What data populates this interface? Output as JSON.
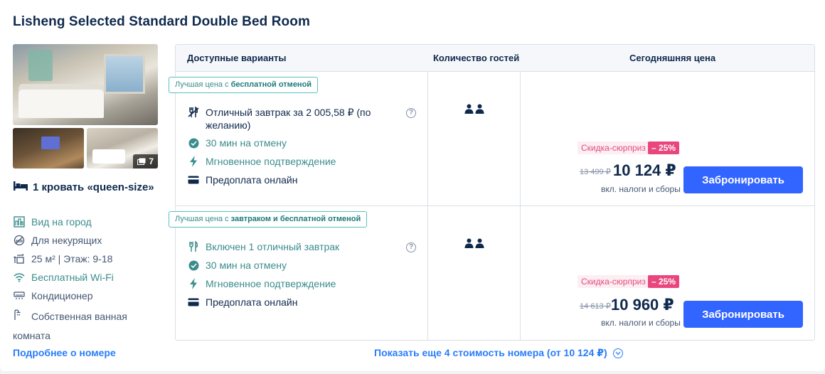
{
  "room": {
    "title": "Lisheng Selected Standard Double Bed Room",
    "photo_count": "7",
    "bed": "1 кровать «queen-size»",
    "amenities": {
      "view": "Вид на город",
      "smoking": "Для некурящих",
      "size_floor": "25 м² | Этаж: 9-18",
      "wifi": "Бесплатный Wi-Fi",
      "ac": "Кондиционер",
      "bathroom": "Собственная ванная комната"
    },
    "more_link": "Подробнее о номере"
  },
  "table": {
    "headers": {
      "options": "Доступные варианты",
      "guests": "Количество гостей",
      "price": "Сегодняшняя цена"
    },
    "offers": [
      {
        "badge_prefix": "Лучшая цена с ",
        "badge_bold": "бесплатной отменой",
        "meal": "Отличный завтрак за 2 005,58 ₽ (по желанию)",
        "cancel": "30 мин на отмену",
        "confirm": "Мгновенное подтверждение",
        "prepay": "Предоплата онлайн",
        "discount_label": "Скидка-сюрприз",
        "discount_pct": "– 25%",
        "old_price": "13 499 ₽",
        "new_price": "10 124 ₽",
        "tax_note": "вкл. налоги и сборы",
        "button": "Забронировать"
      },
      {
        "badge_prefix": "Лучшая цена с ",
        "badge_bold": "завтраком и бесплатной отменой",
        "meal": "Включен 1 отличный завтрак",
        "cancel": "30 мин на отмену",
        "confirm": "Мгновенное подтверждение",
        "prepay": "Предоплата онлайн",
        "discount_label": "Скидка-сюрприз",
        "discount_pct": "– 25%",
        "old_price": "14 613 ₽",
        "new_price": "10 960 ₽",
        "tax_note": "вкл. налоги и сборы",
        "button": "Забронировать"
      }
    ],
    "show_more": "Показать еще 4 стоимость номера (от 10 124 ₽)"
  },
  "colors": {
    "accent": "#3264ff",
    "link": "#287dfa",
    "teal": "#3b8c8c",
    "discount": "#e8467c",
    "text": "#0f294d"
  }
}
